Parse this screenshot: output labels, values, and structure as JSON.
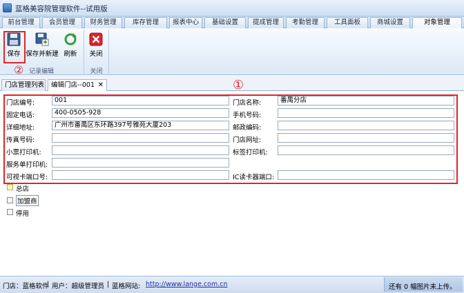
{
  "window": {
    "title": "蓝格美容院管理软件--试用版"
  },
  "menu_tabs": [
    {
      "label": "前台管理"
    },
    {
      "label": "会员管理"
    },
    {
      "label": "财务管理"
    },
    {
      "label": "库存管理"
    },
    {
      "label": "报表中心"
    },
    {
      "label": "基础设置"
    },
    {
      "label": "提成管理"
    },
    {
      "label": "考勤管理"
    },
    {
      "label": "工具面板"
    },
    {
      "label": "商城设置"
    },
    {
      "label": "对象管理"
    }
  ],
  "ribbon": {
    "buttons": {
      "save": "保存",
      "save_new": "保存并新建",
      "refresh": "刷新",
      "close": "关闭"
    },
    "groups": {
      "record_edit": "记录编辑",
      "close": "关闭"
    },
    "colors": {
      "save": "#3a5f9a",
      "refresh": "#3a9a3e",
      "close": "#d8262b"
    }
  },
  "annotations": {
    "one": "①",
    "two": "②",
    "color": "#e0242a"
  },
  "doc_tabs": [
    {
      "label": "门店管理列表"
    },
    {
      "label": "编辑门店--001",
      "close": "✕"
    }
  ],
  "form": {
    "left": [
      {
        "label": "门店编号:",
        "value": "001"
      },
      {
        "label": "固定电话:",
        "value": "400-0505-928"
      },
      {
        "label": "详细地址:",
        "value": "广州市番禺区东环路397号雅苑大厦203"
      },
      {
        "label": "传真号码:",
        "value": ""
      },
      {
        "label": "小票打印机:",
        "value": ""
      },
      {
        "label": "服务单打印机:",
        "value": ""
      },
      {
        "label": "可视卡端口号:",
        "value": ""
      }
    ],
    "right": [
      {
        "label": "门店名称:",
        "value": "番禺分店"
      },
      {
        "label": "手机号码:",
        "value": ""
      },
      {
        "label": "邮政编码:",
        "value": ""
      },
      {
        "label": "门店网址:",
        "value": ""
      },
      {
        "label": "标签打印机:",
        "value": ""
      },
      {
        "label": "IC读卡器端口:",
        "value": ""
      }
    ],
    "checkboxes": [
      {
        "label": "总店"
      },
      {
        "label": "加盟商"
      },
      {
        "label": "停用"
      }
    ]
  },
  "status": {
    "store": "门店：蓝格软件",
    "user": "用户：超级管理员",
    "site_label": "蓝格网站:",
    "site_url": "http://www.lange.com.cn",
    "right_text": "还有 0 幅图片未上传。",
    "sep": "|"
  }
}
